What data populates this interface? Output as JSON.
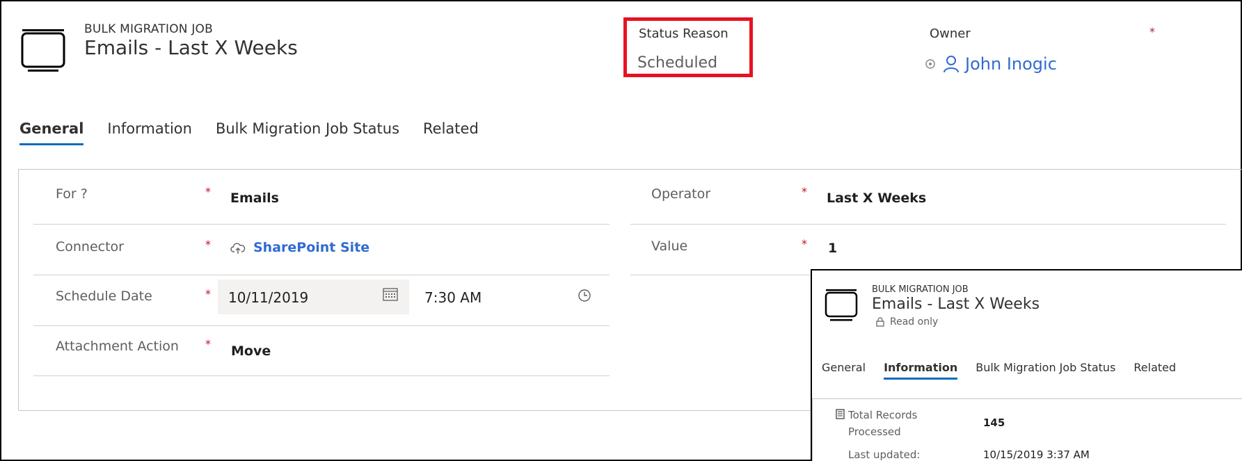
{
  "header": {
    "entity_type": "BULK MIGRATION JOB",
    "title": "Emails - Last X Weeks",
    "status_reason_label": "Status Reason",
    "status_reason_value": "Scheduled",
    "owner_label": "Owner",
    "owner_required": "*",
    "owner_name": "John Inogic"
  },
  "tabs": [
    "General",
    "Information",
    "Bulk Migration Job Status",
    "Related"
  ],
  "form": {
    "for_label": "For ?",
    "for_value": "Emails",
    "connector_label": "Connector",
    "connector_value": "SharePoint Site",
    "schedule_label": "Schedule Date",
    "schedule_date": "10/11/2019",
    "schedule_time": "7:30 AM",
    "attachment_label": "Attachment Action",
    "attachment_value": "Move",
    "operator_label": "Operator",
    "operator_value": "Last X Weeks",
    "value_label": "Value",
    "value_value": "1",
    "required_mark": "*"
  },
  "inset": {
    "entity_type": "BULK MIGRATION JOB",
    "title": "Emails - Last X Weeks",
    "read_only": "Read only",
    "tabs": [
      "General",
      "Information",
      "Bulk Migration Job Status",
      "Related"
    ],
    "total_records_label_1": "Total Records",
    "total_records_label_2": "Processed",
    "total_records_value": "145",
    "last_updated_label": "Last updated:",
    "last_updated_value": "10/15/2019 3:37 AM"
  },
  "colors": {
    "accent": "#0f6cbd",
    "link": "#2f6bd1",
    "highlight_box": "#e81123",
    "required": "#c50f1f"
  }
}
